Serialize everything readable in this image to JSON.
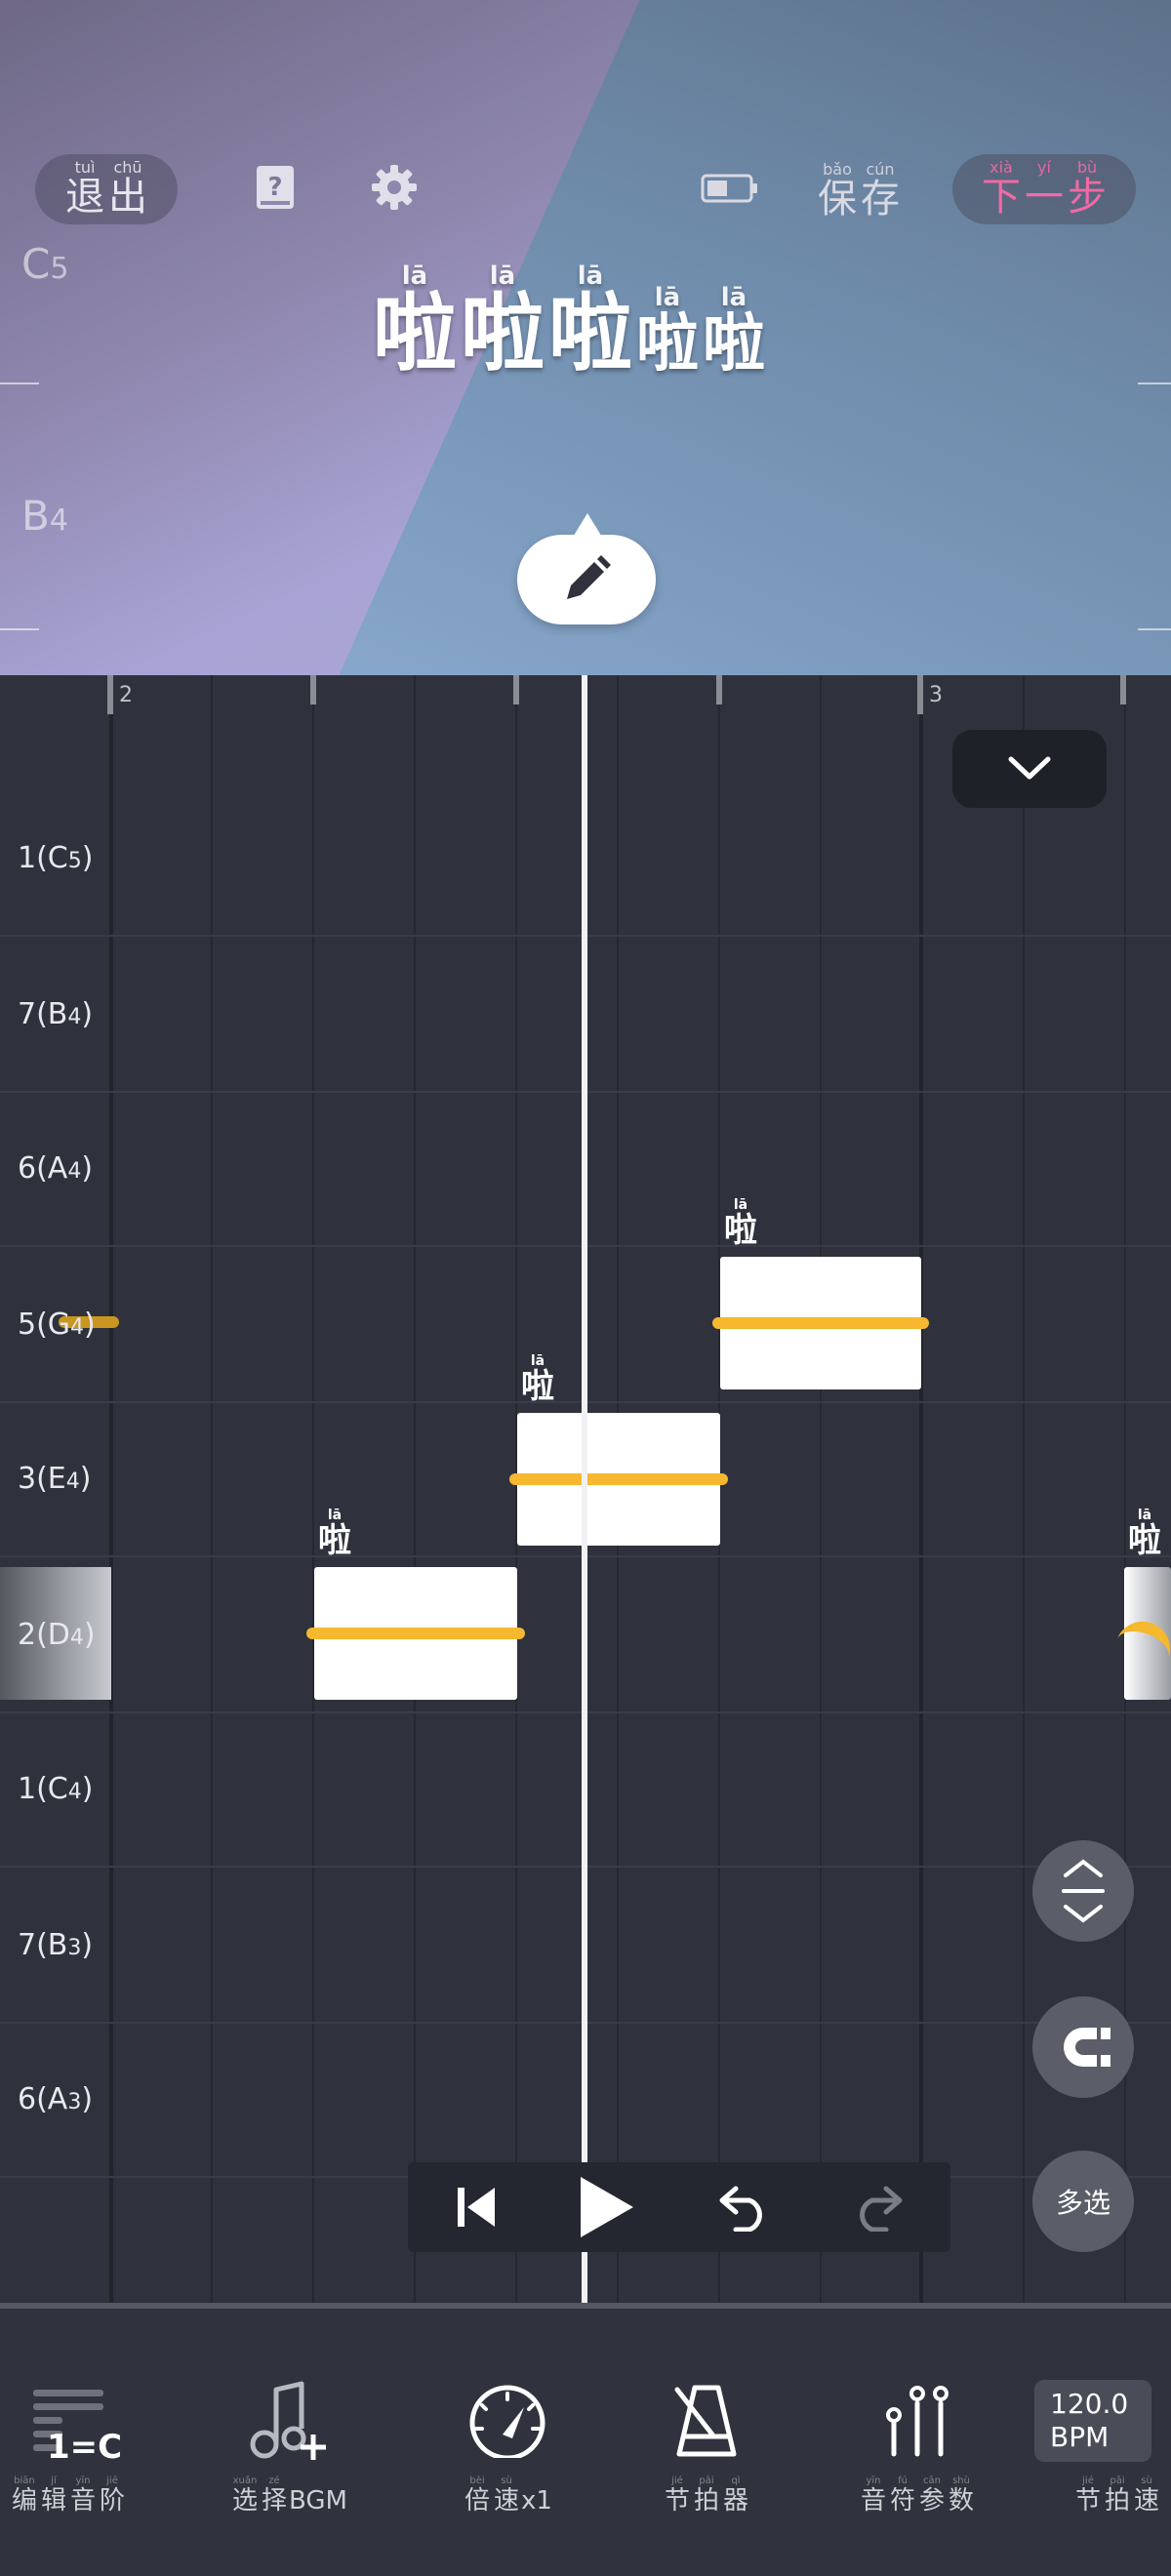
{
  "header": {
    "exit": [
      {
        "py": "tuì",
        "ch": "退"
      },
      {
        "py": "chū",
        "ch": "出"
      }
    ],
    "save": [
      {
        "py": "bǎo",
        "ch": "保"
      },
      {
        "py": "cún",
        "ch": "存"
      }
    ],
    "next": [
      {
        "py": "xià",
        "ch": "下"
      },
      {
        "py": "yí",
        "ch": "一"
      },
      {
        "py": "bù",
        "ch": "步"
      }
    ],
    "pitch_c5": {
      "note": "C",
      "octave": "5"
    },
    "pitch_b4": {
      "note": "B",
      "octave": "4"
    }
  },
  "lyrics": [
    {
      "py": "lā",
      "ch": "啦"
    },
    {
      "py": "lā",
      "ch": "啦"
    },
    {
      "py": "lā",
      "ch": "啦"
    },
    {
      "py": "lā",
      "ch": "啦"
    },
    {
      "py": "lā",
      "ch": "啦"
    }
  ],
  "roll": {
    "bar_numbers": [
      "2",
      "3"
    ],
    "rows": [
      {
        "label": "1(C",
        "oct": "5",
        "close": ")"
      },
      {
        "label": "7(B",
        "oct": "4",
        "close": ")"
      },
      {
        "label": "6(A",
        "oct": "4",
        "close": ")"
      },
      {
        "label": "5(G",
        "oct": "4",
        "close": ")"
      },
      {
        "label": "3(E",
        "oct": "4",
        "close": ")"
      },
      {
        "label": "2(D",
        "oct": "4",
        "close": ")"
      },
      {
        "label": "1(C",
        "oct": "4",
        "close": ")"
      },
      {
        "label": "7(B",
        "oct": "3",
        "close": ")"
      },
      {
        "label": "6(A",
        "oct": "3",
        "close": ")"
      }
    ],
    "notes": [
      {
        "py": "lā",
        "ch": "啦"
      },
      {
        "py": "lā",
        "ch": "啦"
      },
      {
        "py": "lā",
        "ch": "啦"
      },
      {
        "py": "lā",
        "ch": "啦"
      }
    ],
    "multi_select": "多选"
  },
  "toolbar": {
    "scale_badge": "1=C",
    "scale": [
      {
        "py": "biān",
        "ch": "编"
      },
      {
        "py": "jí",
        "ch": "辑"
      },
      {
        "py": "yīn",
        "ch": "音"
      },
      {
        "py": "jiē",
        "ch": "阶"
      }
    ],
    "bgm": {
      "zh": [
        {
          "py": "xuǎn",
          "ch": "选"
        },
        {
          "py": "zé",
          "ch": "择"
        }
      ],
      "suffix": "BGM"
    },
    "speed": {
      "zh": [
        {
          "py": "bèi",
          "ch": "倍"
        },
        {
          "py": "sù",
          "ch": "速"
        }
      ],
      "suffix": "x1"
    },
    "metronome": [
      {
        "py": "jié",
        "ch": "节"
      },
      {
        "py": "pāi",
        "ch": "拍"
      },
      {
        "py": "qì",
        "ch": "器"
      }
    ],
    "params": [
      {
        "py": "yīn",
        "ch": "音"
      },
      {
        "py": "fú",
        "ch": "符"
      },
      {
        "py": "cān",
        "ch": "参"
      },
      {
        "py": "shù",
        "ch": "数"
      }
    ],
    "tempo_value": "120.0",
    "tempo_unit": "BPM",
    "tempo": [
      {
        "py": "jié",
        "ch": "节"
      },
      {
        "py": "pāi",
        "ch": "拍"
      },
      {
        "py": "sù",
        "ch": "速"
      }
    ]
  },
  "colors": {
    "accent_pink": "#f26aa6",
    "pitch_line": "#f5b82e",
    "note_fill": "#ffffff"
  }
}
